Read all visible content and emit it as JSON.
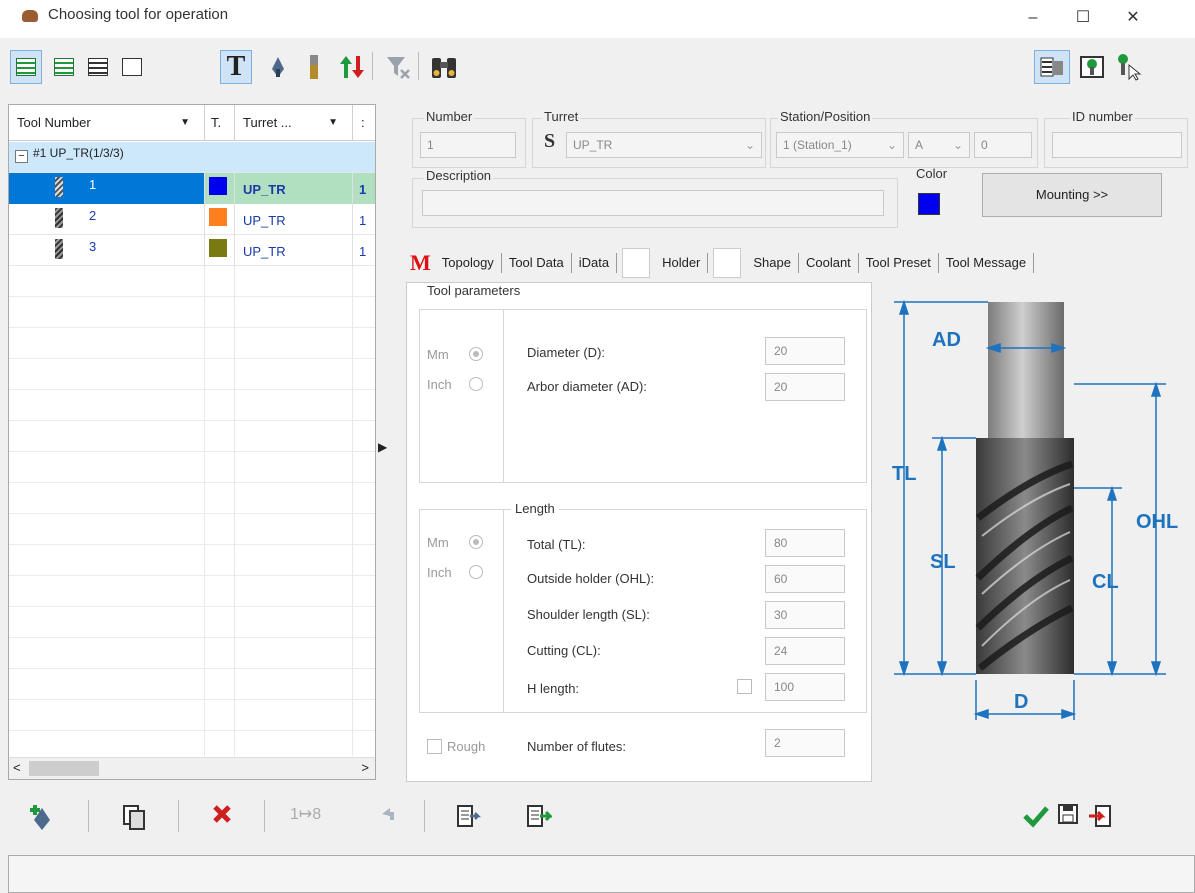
{
  "window": {
    "title": "Choosing tool for operation",
    "minimize": "–",
    "maximize": "☐",
    "close": "✕"
  },
  "toolbar": {
    "text_tool": "T",
    "colors": {
      "active_bg": "#cfe3f7",
      "active_border": "#7fb0de"
    }
  },
  "grid": {
    "headers": [
      "Tool Number",
      "T.",
      "Turret ...",
      ":"
    ],
    "group_label": "#1 UP_TR(1/3/3)",
    "expander": "−",
    "rows": [
      {
        "num": "1",
        "color": "#0000ee",
        "turret": "UP_TR",
        "pos": "1"
      },
      {
        "num": "2",
        "color": "#ff7f1f",
        "turret": "UP_TR",
        "pos": "1"
      },
      {
        "num": "3",
        "color": "#7a7a12",
        "turret": "UP_TR",
        "pos": "1"
      }
    ],
    "scroll_left": "<",
    "scroll_right": ">",
    "selected_color": "#0078d7"
  },
  "form": {
    "number_label": "Number",
    "number_value": "1",
    "turret_label": "Turret",
    "turret_icon": "S",
    "turret_value": "UP_TR",
    "station_label": "Station/Position",
    "station_value": "1 (Station_1)",
    "position_value": "A",
    "position_extra": "0",
    "id_label": "ID number",
    "id_value": "",
    "description_label": "Description",
    "description_value": "",
    "color_label": "Color",
    "mounting_label": "Mounting >>"
  },
  "tabs": {
    "m_icon": "M",
    "items": [
      "Topology",
      "Tool Data",
      "iData",
      "Holder",
      "Shape",
      "Coolant",
      "Tool Preset",
      "Tool Message"
    ]
  },
  "tool_parameters": {
    "group_label": "Tool parameters",
    "mm": "Mm",
    "inch": "Inch",
    "diameter_label": "Diameter (D):",
    "diameter_value": "20",
    "arbor_label": "Arbor diameter (AD):",
    "arbor_value": "20"
  },
  "length": {
    "group_label": "Length",
    "mm": "Mm",
    "inch": "Inch",
    "total_label": "Total (TL):",
    "total_value": "80",
    "ohl_label": "Outside holder (OHL):",
    "ohl_value": "60",
    "sl_label": "Shoulder length (SL):",
    "sl_value": "30",
    "cl_label": "Cutting (CL):",
    "cl_value": "24",
    "h_label": "H length:",
    "h_value": "100"
  },
  "flutes": {
    "rough_label": "Rough",
    "flutes_label": "Number of flutes:",
    "flutes_value": "2"
  },
  "diagram": {
    "AD": "AD",
    "TL": "TL",
    "SL": "SL",
    "OHL": "OHL",
    "CL": "CL",
    "D": "D",
    "dim_color": "#1e73be"
  }
}
